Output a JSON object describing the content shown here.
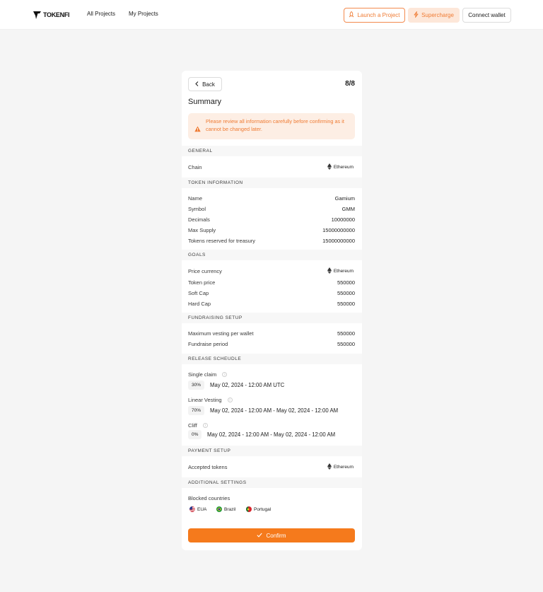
{
  "nav": {
    "logo_text": "TOKENFI",
    "links": [
      "All Projects",
      "My Projects"
    ],
    "launch_label": "Launch a Project",
    "supercharge_label": "Supercharge",
    "wallet_label": "Connect wallet"
  },
  "card": {
    "back_label": "Back",
    "step": "8/8",
    "title": "Summary",
    "alert": "Please review all information carefully before confirming as it cannot be changed later."
  },
  "general": {
    "header": "GENERAL",
    "chain_label": "Chain",
    "chain_value": "Ethereum"
  },
  "token": {
    "header": "TOKEN INFORMATION",
    "rows": [
      {
        "label": "Name",
        "value": "Gamium"
      },
      {
        "label": "Symbol",
        "value": "GMM"
      },
      {
        "label": "Decimals",
        "value": "10000000"
      },
      {
        "label": "Max Supply",
        "value": "15000000000"
      },
      {
        "label": "Tokens reserved for treasury",
        "value": "15000000000"
      }
    ]
  },
  "goals": {
    "header": "GOALS",
    "currency_label": "Price currency",
    "currency_value": "Ethereum",
    "rows": [
      {
        "label": "Token price",
        "value": "550000"
      },
      {
        "label": "Soft Cap",
        "value": "550000"
      },
      {
        "label": "Hard Cap",
        "value": "550000"
      }
    ]
  },
  "fundraising": {
    "header": "FUNDRAISING SETUP",
    "rows": [
      {
        "label": "Maximum vesting per wallet",
        "value": "550000"
      },
      {
        "label": "Fundraise period",
        "value": "550000"
      }
    ]
  },
  "release": {
    "header": "RELEASE SCHEUDLE",
    "items": [
      {
        "label": "Single claim",
        "pct": "30%",
        "date": "May 02, 2024 - 12:00 AM UTC"
      },
      {
        "label": "Linear Vesting",
        "pct": "70%",
        "date": "May 02, 2024 - 12:00 AM - May 02, 2024 - 12:00 AM"
      },
      {
        "label": "Cliff",
        "pct": "0%",
        "date": "May 02, 2024 - 12:00 AM - May 02, 2024 - 12:00 AM"
      }
    ]
  },
  "payment": {
    "header": "PAYMENT SETUP",
    "label": "Accepted tokens",
    "value": "Ethereum"
  },
  "additional": {
    "header": "ADDITIONAL SETTINGS",
    "label": "Blocked countries",
    "countries": [
      "EUA",
      "Brazil",
      "Portugal"
    ]
  },
  "confirm_label": "Confirm",
  "colors": {
    "accent": "#f57a1c",
    "alert_bg": "#fdeee4",
    "alert_text": "#ef7b33",
    "page_bg": "#f5f5f5"
  }
}
